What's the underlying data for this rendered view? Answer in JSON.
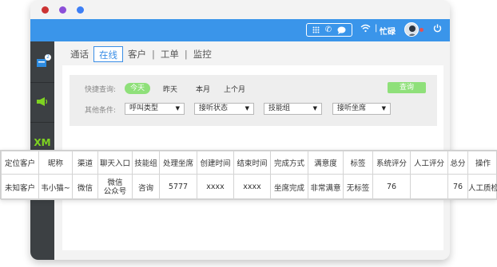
{
  "window": {
    "traffic_colors": [
      "#cc3333",
      "#8c4fd8",
      "#3d7ff5"
    ],
    "topbar_color": "#3a95ea",
    "status_label": "忙碌",
    "status_dot_color": "#e65050"
  },
  "sidebar": {
    "background": "#3c4043",
    "items": [
      {
        "icon": "chat-window-icon",
        "badge": "2"
      },
      {
        "icon": "megaphone-icon"
      },
      {
        "icon": "xm-logo-icon",
        "label": "XM"
      }
    ]
  },
  "tabs": [
    {
      "label": "通话",
      "active": false
    },
    {
      "label": "在线",
      "active": true
    },
    {
      "label": "客户",
      "active": false
    },
    {
      "label": "工单",
      "active": false
    },
    {
      "label": "监控",
      "active": false
    }
  ],
  "filters": {
    "quick_label": "快捷查询:",
    "quick_options": [
      "今天",
      "昨天",
      "本月",
      "上个月"
    ],
    "query_button": "查询",
    "other_label": "其他条件:",
    "selects": [
      "呼叫类型",
      "接听状态",
      "技能组",
      "接听坐席"
    ]
  },
  "table": {
    "headers": [
      "定位客户",
      "昵称",
      "渠道",
      "聊天入口",
      "技能组",
      "处理坐席",
      "创建时间",
      "结束时间",
      "完成方式",
      "满意度",
      "标签",
      "系统评分",
      "人工评分",
      "总分",
      "操作"
    ],
    "rows": [
      [
        "未知客户",
        "韦小猫~",
        "微信",
        "微信\n公众号",
        "咨询",
        "5777",
        "xxxx",
        "xxxx",
        "坐席完成",
        "非常满意",
        "无标签",
        "76",
        "",
        "76",
        "人工质检"
      ]
    ]
  }
}
